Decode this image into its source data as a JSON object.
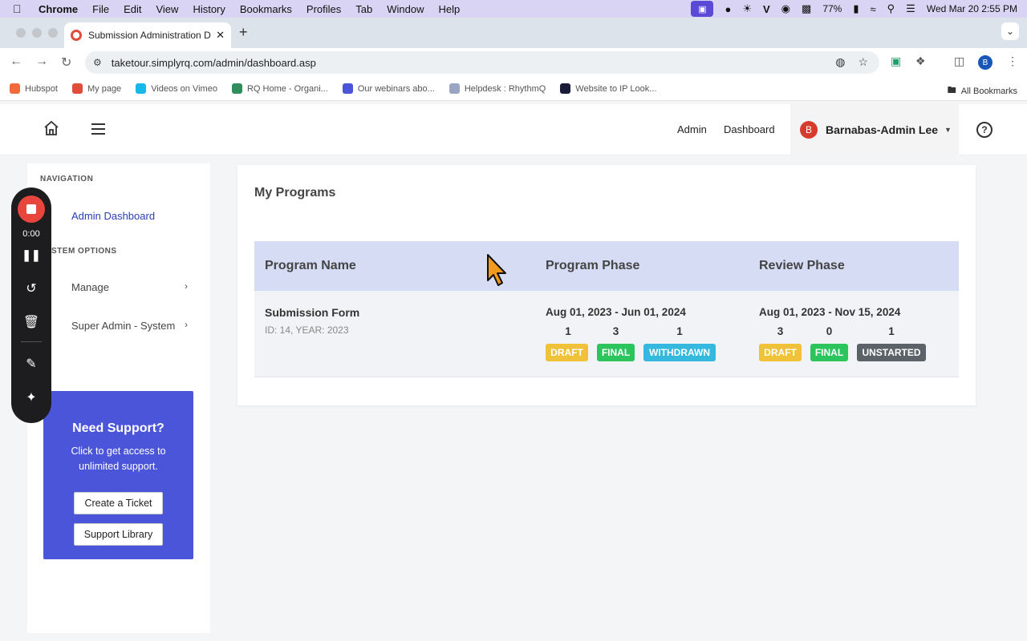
{
  "menubar": {
    "app": "Chrome",
    "items": [
      "File",
      "Edit",
      "View",
      "History",
      "Bookmarks",
      "Profiles",
      "Tab",
      "Window",
      "Help"
    ],
    "battery": "77%",
    "datetime": "Wed Mar 20  2:55 PM"
  },
  "browser": {
    "tab_title": "Submission Administration Da",
    "url": "taketour.simplyrq.com/admin/dashboard.asp",
    "profile_initial": "B",
    "bookmarks": [
      {
        "label": "Hubspot",
        "color": "#f26a3b"
      },
      {
        "label": "My page",
        "color": "#e04b3a"
      },
      {
        "label": "Videos on Vimeo",
        "color": "#1ab7ea"
      },
      {
        "label": "RQ Home - Organi...",
        "color": "#2f8f5b"
      },
      {
        "label": "Our webinars abo...",
        "color": "#4b55d9"
      },
      {
        "label": "Helpdesk : RhythmQ",
        "color": "#9aa5c2"
      },
      {
        "label": "Website to IP Look...",
        "color": "#1a1a3a"
      }
    ],
    "all_bookmarks": "All Bookmarks"
  },
  "header": {
    "links": [
      "Admin",
      "Dashboard"
    ],
    "user_initial": "B",
    "user_name": "Barnabas-Admin Lee"
  },
  "sidebar": {
    "nav_heading": "NAVIGATION",
    "active_item": "Admin Dashboard",
    "options_heading": "STEM OPTIONS",
    "items": [
      "Manage",
      "Super Admin - System"
    ],
    "support": {
      "title": "Need Support?",
      "desc": "Click to get access to unlimited support.",
      "btn_ticket": "Create a Ticket",
      "btn_library": "Support Library"
    }
  },
  "recorder": {
    "time": "0:00"
  },
  "main": {
    "title": "My Programs",
    "columns": [
      "Program Name",
      "Program Phase",
      "Review Phase"
    ],
    "rows": [
      {
        "name": "Submission Form",
        "meta": "ID: 14, YEAR: 2023",
        "program_phase": {
          "dates": "Aug 01, 2023 - Jun 01, 2024",
          "counts": [
            "1",
            "3",
            "1"
          ],
          "badges": [
            "DRAFT",
            "FINAL",
            "WITHDRAWN"
          ]
        },
        "review_phase": {
          "dates": "Aug 01, 2023 - Nov 15, 2024",
          "counts": [
            "3",
            "0",
            "1"
          ],
          "badges": [
            "DRAFT",
            "FINAL",
            "UNSTARTED"
          ]
        }
      }
    ]
  }
}
